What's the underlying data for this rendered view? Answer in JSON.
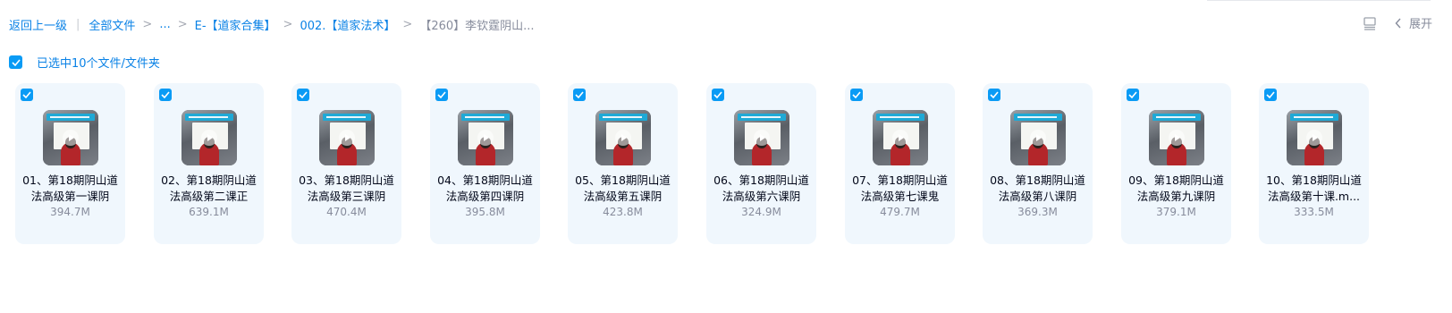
{
  "breadcrumb": {
    "back": "返回上一级",
    "all_files": "全部文件",
    "ellipsis": "...",
    "level1": "E-【道家合集】",
    "level2": "002.【道家法术】",
    "current": "【260】李钦霆阴山..."
  },
  "toolbar": {
    "list_icon": "list-view-icon",
    "expand_label": "展开"
  },
  "selection": {
    "label": "已选中10个文件/文件夹",
    "checked": true
  },
  "accent_color": "#0a9bf5",
  "files": [
    {
      "line1": "01、第18期阴山道",
      "line2": "法高级第一课阴",
      "size": "394.7M"
    },
    {
      "line1": "02、第18期阴山道",
      "line2": "法高级第二课正",
      "size": "639.1M"
    },
    {
      "line1": "03、第18期阴山道",
      "line2": "法高级第三课阴",
      "size": "470.4M"
    },
    {
      "line1": "04、第18期阴山道",
      "line2": "法高级第四课阴",
      "size": "395.8M"
    },
    {
      "line1": "05、第18期阴山道",
      "line2": "法高级第五课阴",
      "size": "423.8M"
    },
    {
      "line1": "06、第18期阴山道",
      "line2": "法高级第六课阴",
      "size": "324.9M"
    },
    {
      "line1": "07、第18期阴山道",
      "line2": "法高级第七课鬼",
      "size": "479.7M"
    },
    {
      "line1": "08、第18期阴山道",
      "line2": "法高级第八课阴",
      "size": "369.3M"
    },
    {
      "line1": "09、第18期阴山道",
      "line2": "法高级第九课阴",
      "size": "379.1M"
    },
    {
      "line1": "10、第18期阴山道",
      "line2": "法高级第十课.m...",
      "size": "333.5M"
    }
  ]
}
